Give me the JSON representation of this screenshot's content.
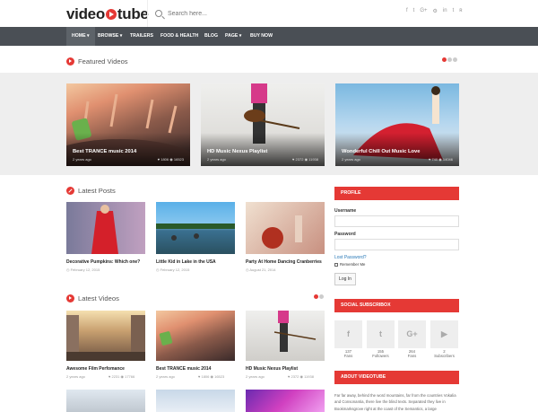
{
  "header": {
    "logo_text": "video",
    "logo_text2": "tube",
    "search_placeholder": "Search here...",
    "social_icons": [
      "f",
      "t",
      "G+",
      "⚙",
      "in",
      "t",
      "ʀ"
    ]
  },
  "nav": {
    "items": [
      {
        "label": "HOME ▾",
        "active": true
      },
      {
        "label": "BROWSE ▾"
      },
      {
        "label": "TRAILERS"
      },
      {
        "label": "FOOD & HEALTH"
      },
      {
        "label": "BLOG"
      },
      {
        "label": "PAGE ▾"
      },
      {
        "label": "BUY NOW"
      }
    ]
  },
  "featured": {
    "title": "Featured Videos",
    "cards": [
      {
        "title": "Best TRANCE music 2014",
        "age": "2 years ago",
        "likes": "♥ 1806",
        "views": "◉ 16523"
      },
      {
        "title": "HD Music Nexus Playlist",
        "age": "2 years ago",
        "likes": "♥ 2372",
        "views": "◉ 11938"
      },
      {
        "title": "Wonderful Chill Out Music Love",
        "age": "2 years ago",
        "likes": "♥ 740",
        "views": "◉ 14046"
      }
    ]
  },
  "latest_posts": {
    "title": "Latest Posts",
    "posts": [
      {
        "title": "Decorative Pumpkins: Which one?",
        "date": "February 12, 2015"
      },
      {
        "title": "Little Kid in Lake in the USA",
        "date": "February 12, 2015"
      },
      {
        "title": "Party At Home Dancing Cranberries",
        "date": "August 21, 2014"
      }
    ]
  },
  "latest_videos": {
    "title": "Latest Videos",
    "videos": [
      {
        "title": "Awesome Film Perfomance",
        "age": "2 years ago",
        "stats": "♥ 2231  ◉ 17766"
      },
      {
        "title": "Best TRANCE music 2014",
        "age": "2 years ago",
        "stats": "♥ 1806  ◉ 16523"
      },
      {
        "title": "HD Music Nexus Playlist",
        "age": "2 years ago",
        "stats": "♥ 2372  ◉ 11938"
      }
    ]
  },
  "sidebar": {
    "profile": {
      "title": "PROFILE",
      "username_label": "Username",
      "password_label": "Password",
      "lost_password": "Lost Password?",
      "remember_me": "Remember Me",
      "login_button": "Log In"
    },
    "social": {
      "title": "SOCIAL SUBSCRIBOX",
      "items": [
        {
          "icon": "f",
          "count": "137",
          "label": "Fans"
        },
        {
          "icon": "t",
          "count": "155",
          "label": "Followers"
        },
        {
          "icon": "G+",
          "count": "264",
          "label": "Fans"
        },
        {
          "icon": "▶",
          "count": "2",
          "label": "Subscribers"
        }
      ]
    },
    "about": {
      "title": "ABOUT VIDEOTUBE",
      "text": "Far far away, behind the word mountains, far from the countries Vokalia and Consonantia, there live the blind texts. Separated they live in Bookmarksgrove right at the coast of the Semantics, a large"
    }
  },
  "colors": {
    "accent": "#e53935",
    "nav": "#4a4f55"
  }
}
